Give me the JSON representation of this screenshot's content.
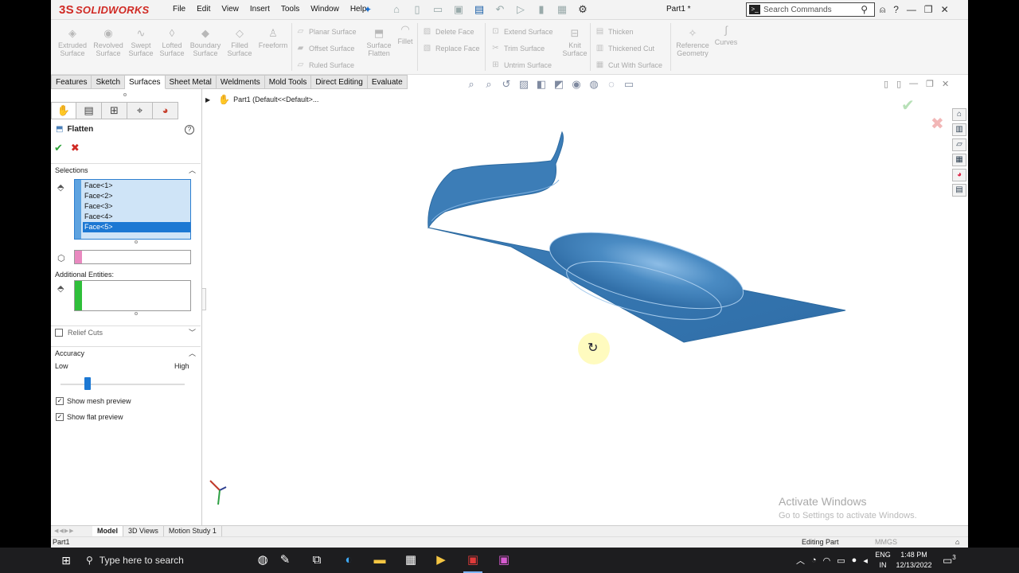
{
  "app": {
    "logo": "SOLIDWORKS",
    "logo_mark": "3S",
    "document_title": "Part1 *"
  },
  "menu": [
    "File",
    "Edit",
    "View",
    "Insert",
    "Tools",
    "Window",
    "Help"
  ],
  "search": {
    "placeholder": "Search Commands"
  },
  "ribbon": {
    "large_buttons": [
      {
        "line1": "Extruded",
        "line2": "Surface"
      },
      {
        "line1": "Revolved",
        "line2": "Surface"
      },
      {
        "line1": "Swept",
        "line2": "Surface"
      },
      {
        "line1": "Lofted",
        "line2": "Surface"
      },
      {
        "line1": "Boundary",
        "line2": "Surface"
      },
      {
        "line1": "Filled",
        "line2": "Surface"
      },
      {
        "line1": "Freeform",
        "line2": ""
      }
    ],
    "group1": [
      "Planar Surface",
      "Offset Surface",
      "Ruled Surface"
    ],
    "surface_flatten": {
      "line1": "Surface",
      "line2": "Flatten"
    },
    "fillet": "Fillet",
    "group2": [
      "Delete Face",
      "Replace Face"
    ],
    "group3": [
      "Extend Surface",
      "Trim Surface",
      "Untrim Surface"
    ],
    "knit": {
      "line1": "Knit",
      "line2": "Surface"
    },
    "group4": [
      "Thicken",
      "Thickened Cut",
      "Cut With Surface"
    ],
    "reference": {
      "line1": "Reference",
      "line2": "Geometry"
    },
    "curves": "Curves"
  },
  "tabs": [
    "Features",
    "Sketch",
    "Surfaces",
    "Sheet Metal",
    "Weldments",
    "Mold Tools",
    "Direct Editing",
    "Evaluate"
  ],
  "active_tab": "Surfaces",
  "property_manager": {
    "title": "Flatten",
    "selections_header": "Selections",
    "faces": [
      "Face<1>",
      "Face<2>",
      "Face<3>",
      "Face<4>",
      "Face<5>"
    ],
    "selected_face": "Face<5>",
    "additional_entities_label": "Additional Entities:",
    "relief_cuts_label": "Relief Cuts",
    "accuracy_header": "Accuracy",
    "accuracy_low": "Low",
    "accuracy_high": "High",
    "accuracy_level_fraction": 0.22,
    "show_mesh_preview": "Show mesh preview",
    "show_flat_preview": "Show flat preview"
  },
  "tree": {
    "part_label": "Part1  (Default<<Default>..."
  },
  "watermark": {
    "title": "Activate Windows",
    "subtitle": "Go to Settings to activate Windows."
  },
  "bottom_tabs": [
    "Model",
    "3D Views",
    "Motion Study 1"
  ],
  "status_bar": {
    "left": "Part1",
    "mode": "Editing Part",
    "units": "MMGS"
  },
  "taskbar": {
    "search_placeholder": "Type here to search",
    "lang_line1": "ENG",
    "lang_line2": "IN",
    "time": "1:48 PM",
    "date": "12/13/2022",
    "notif_count": "3"
  },
  "colors": {
    "model_blue": "#3d7fb8",
    "selection_blue": "#1c78d3",
    "solidworks_red": "#d02a24"
  }
}
